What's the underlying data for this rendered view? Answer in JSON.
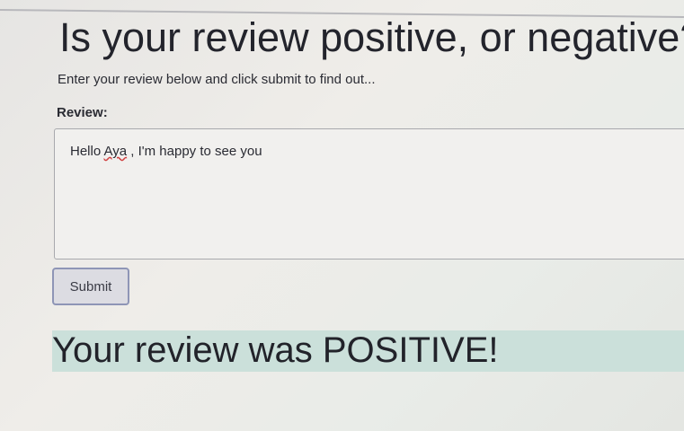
{
  "page": {
    "title": "Is your review positive, or negative?",
    "subtitle": "Enter your review below and click submit to find out...",
    "review_label": "Review:",
    "review_value_prefix": "Hello ",
    "review_value_misspelled": "Aya",
    "review_value_suffix": " , I'm happy to see you",
    "submit_label": "Submit",
    "result": "Your review was POSITIVE!"
  },
  "colors": {
    "result_bg": "#cbe0da",
    "button_border": "#8e95b6"
  }
}
